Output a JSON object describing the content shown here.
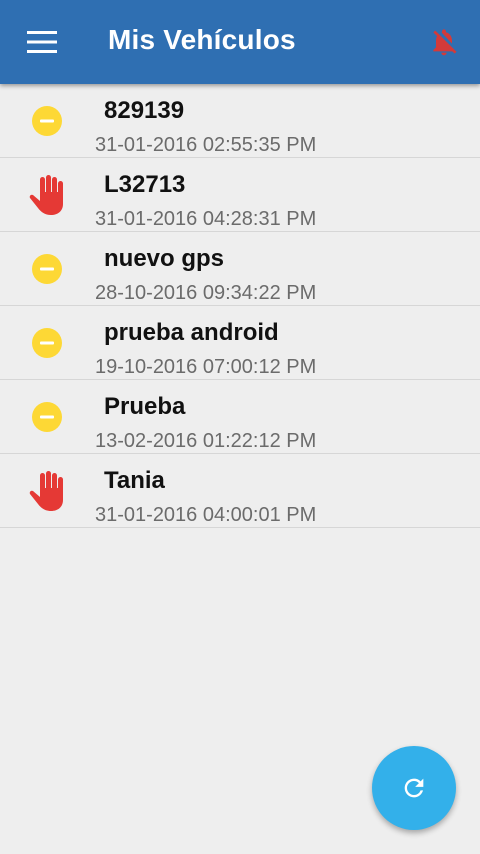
{
  "appbar": {
    "title": "Mis Vehículos",
    "menu_icon": "hamburger-menu-icon",
    "bell_icon": "bell-off-icon",
    "color": "#2f6fb2",
    "bell_color": "#d33a3a"
  },
  "vehicles": [
    {
      "name": "829139",
      "timestamp": "31-01-2016 02:55:35 PM",
      "status_icon": "minus-circle-icon"
    },
    {
      "name": "L32713",
      "timestamp": "31-01-2016 04:28:31 PM",
      "status_icon": "stop-hand-icon"
    },
    {
      "name": "nuevo gps",
      "timestamp": "28-10-2016 09:34:22 PM",
      "status_icon": "minus-circle-icon"
    },
    {
      "name": "prueba android",
      "timestamp": "19-10-2016 07:00:12 PM",
      "status_icon": "minus-circle-icon"
    },
    {
      "name": "Prueba",
      "timestamp": "13-02-2016 01:22:12 PM",
      "status_icon": "minus-circle-icon"
    },
    {
      "name": "Tania",
      "timestamp": "31-01-2016 04:00:01 PM",
      "status_icon": "stop-hand-icon"
    }
  ],
  "status_colors": {
    "idle": "#fdd835",
    "stopped": "#e53935"
  },
  "fab": {
    "icon": "refresh-icon",
    "color": "#33b0ea"
  }
}
